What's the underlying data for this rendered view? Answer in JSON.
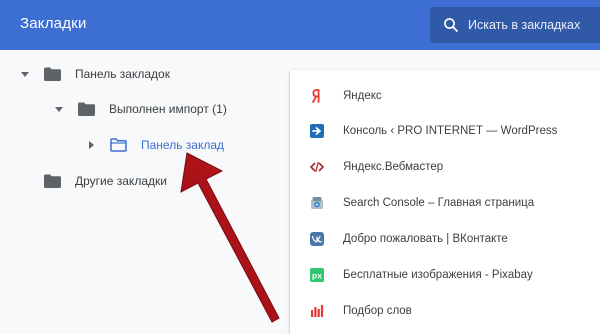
{
  "header": {
    "title": "Закладки",
    "search_placeholder": "Искать в закладках",
    "search_icon": "search-icon"
  },
  "tree": {
    "items": [
      {
        "label": "Панель закладок",
        "expanded": true,
        "icon": "folder-icon"
      },
      {
        "label": "Выполнен импорт (1)",
        "expanded": true,
        "icon": "folder-icon"
      },
      {
        "label": "Панель заклад",
        "expanded": false,
        "selected": true,
        "icon": "folder-outline-icon"
      },
      {
        "label": "Другие закладки",
        "icon": "folder-icon"
      }
    ]
  },
  "bookmarks": [
    {
      "title": "Яндекс",
      "icon": "yandex-icon",
      "color": "#e53935"
    },
    {
      "title": "Консоль ‹ PRO INTERNET — WordPress",
      "icon": "arrow-right-icon",
      "color": "#1e6fb8"
    },
    {
      "title": "Яндекс.Вебмастер",
      "icon": "code-icon",
      "color": "#9c2b2b"
    },
    {
      "title": "Search Console – Главная страница",
      "icon": "search-console-icon",
      "color": "#607d8b"
    },
    {
      "title": "Добро пожаловать | ВКонтакте",
      "icon": "vk-icon",
      "color": "#4a76a8"
    },
    {
      "title": "Бесплатные изображения - Pixabay",
      "icon": "pixabay-icon",
      "color": "#2ec66e"
    },
    {
      "title": "Подбор слов",
      "icon": "bar-chart-icon",
      "color": "#e53935"
    }
  ],
  "colors": {
    "header": "#3c6fd1",
    "search_bg": "#3059a8",
    "selected": "#3c6fd1",
    "annotation_arrow": "#b3141c"
  }
}
